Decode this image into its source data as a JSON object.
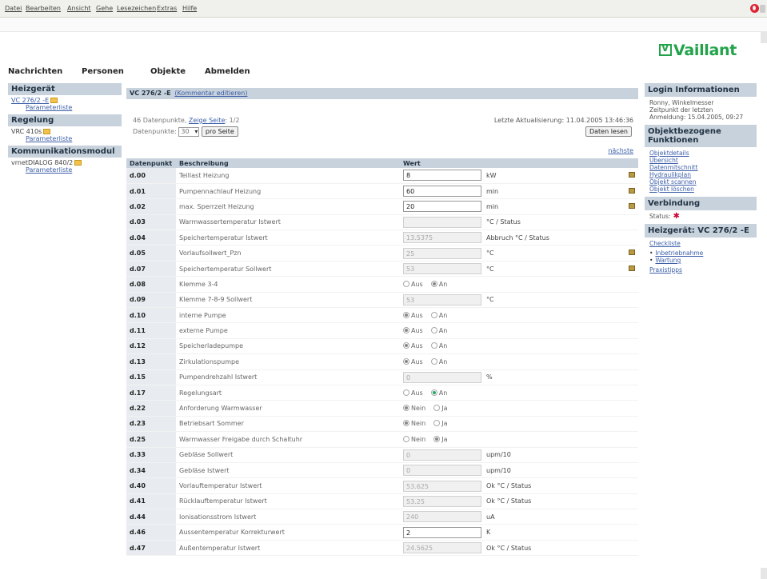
{
  "browser": {
    "menu": [
      "Datei",
      "Bearbeiten",
      "Ansicht",
      "Gehe",
      "Lesezeichen",
      "Extras",
      "Hilfe"
    ]
  },
  "logo": "Vaillant",
  "nav": [
    "Nachrichten",
    "Personen",
    "Objekte",
    "Abmelden"
  ],
  "left": {
    "heizgeraet": {
      "title": "Heizgerät",
      "item": "VC 276/2 -E",
      "sub": "Parameterliste"
    },
    "regelung": {
      "title": "Regelung",
      "item": "VRC 410s",
      "sub": "Parameterliste"
    },
    "kommunikation": {
      "title": "Kommunikationsmodul",
      "item": "vrnetDIALOG 840/2",
      "sub": "Parameterliste"
    }
  },
  "main": {
    "title": "VC 276/2 -E",
    "edit_link": "(Kommentar editieren)",
    "count": "46 Datenpunkte",
    "page_label": "Zeige Seite",
    "page_value": "1/2",
    "per_page_label": "Datenpunkte",
    "per_page_value": "30",
    "per_page_button": "pro Seite",
    "updated": "Letzte Aktualisierung: 11.04.2005 13:46:36",
    "read_button": "Daten lesen",
    "next": "nächste",
    "col_dp": "Datenpunkt",
    "col_desc": "Beschreibung",
    "col_val": "Wert"
  },
  "rows": [
    {
      "dp": "d.00",
      "desc": "Teillast Heizung",
      "value": "8",
      "unit": "kW",
      "editable": true
    },
    {
      "dp": "d.01",
      "desc": "Pumpennachlauf Heizung",
      "value": "60",
      "unit": "min",
      "editable": true
    },
    {
      "dp": "d.02",
      "desc": "max. Sperrzeit Heizung",
      "value": "20",
      "unit": "min",
      "editable": true
    },
    {
      "dp": "d.03",
      "desc": "Warmwassertemperatur Istwert",
      "value": "",
      "unit": "°C / Status",
      "editable": false,
      "ro": true
    },
    {
      "dp": "d.04",
      "desc": "Speichertemperatur Istwert",
      "value": "13.5375",
      "unit": "Abbruch °C / Status",
      "editable": false,
      "ro": true
    },
    {
      "dp": "d.05",
      "desc": "Vorlaufsollwert_Pzn",
      "value": "25",
      "unit": "°C",
      "editable": true,
      "ro": true
    },
    {
      "dp": "d.07",
      "desc": "Speichertemperatur Sollwert",
      "value": "53",
      "unit": "°C",
      "editable": true,
      "ro": true
    },
    {
      "dp": "d.08",
      "desc": "Klemme 3-4",
      "radio": [
        "Aus",
        "An"
      ],
      "sel": 1
    },
    {
      "dp": "d.09",
      "desc": "Klemme 7-8-9 Sollwert",
      "value": "53",
      "unit": "°C",
      "editable": false,
      "ro": true
    },
    {
      "dp": "d.10",
      "desc": "interne Pumpe",
      "radio": [
        "Aus",
        "An"
      ],
      "sel": 0
    },
    {
      "dp": "d.11",
      "desc": "externe Pumpe",
      "radio": [
        "Aus",
        "An"
      ],
      "sel": 0
    },
    {
      "dp": "d.12",
      "desc": "Speicherladepumpe",
      "radio": [
        "Aus",
        "An"
      ],
      "sel": 0
    },
    {
      "dp": "d.13",
      "desc": "Zirkulationspumpe",
      "radio": [
        "Aus",
        "An"
      ],
      "sel": 0
    },
    {
      "dp": "d.15",
      "desc": "Pumpendrehzahl Istwert",
      "value": "0",
      "unit": "%",
      "editable": false,
      "ro": true
    },
    {
      "dp": "d.17",
      "desc": "Regelungsart",
      "radio": [
        "Aus",
        "An"
      ],
      "sel": 1,
      "active": true
    },
    {
      "dp": "d.22",
      "desc": "Anforderung Warmwasser",
      "radio": [
        "Nein",
        "Ja"
      ],
      "sel": 0
    },
    {
      "dp": "d.23",
      "desc": "Betriebsart Sommer",
      "radio": [
        "Nein",
        "Ja"
      ],
      "sel": 0
    },
    {
      "dp": "d.25",
      "desc": "Warmwasser Freigabe durch Schaltuhr",
      "radio": [
        "Nein",
        "Ja"
      ],
      "sel": 1
    },
    {
      "dp": "d.33",
      "desc": "Gebläse Sollwert",
      "value": "0",
      "unit": "upm/10",
      "editable": false,
      "ro": true
    },
    {
      "dp": "d.34",
      "desc": "Gebläse Istwert",
      "value": "0",
      "unit": "upm/10",
      "editable": false,
      "ro": true
    },
    {
      "dp": "d.40",
      "desc": "Vorlauftemperatur Istwert",
      "value": "53.625",
      "unit": "Ok °C / Status",
      "editable": false,
      "ro": true
    },
    {
      "dp": "d.41",
      "desc": "Rücklauftemperatur Istwert",
      "value": "53.25",
      "unit": "Ok °C / Status",
      "editable": false,
      "ro": true
    },
    {
      "dp": "d.44",
      "desc": "Ionisationsstrom Istwert",
      "value": "240",
      "unit": "uA",
      "editable": false,
      "ro": true
    },
    {
      "dp": "d.46",
      "desc": "Aussentemperatur Korrekturwert",
      "value": "2",
      "unit": "K",
      "editable": false
    },
    {
      "dp": "d.47",
      "desc": "Außentemperatur Istwert",
      "value": "24.5625",
      "unit": "Ok °C / Status",
      "editable": false,
      "ro": true
    }
  ],
  "right": {
    "login": {
      "title": "Login Informationen",
      "name": "Ronny, Winkelmesser",
      "since": "Zeitpunkt der letzten",
      "last": "Anmeldung: 15.04.2005, 09:27"
    },
    "functions": {
      "title": "Objektbezogene Funktionen",
      "links": [
        "Objektdetails",
        "Übersicht",
        "Datenmitschnitt",
        "Hydraulikplan",
        "Objekt scannen",
        "Objekt löschen"
      ]
    },
    "connection": {
      "title": "Verbindung",
      "status": "Status:"
    },
    "device": {
      "title": "Heizgerät: VC 276/2 -E",
      "checklist": "Checkliste",
      "bullets": [
        "Inbetriebnahme",
        "Wartung"
      ],
      "last": "Praxistipps"
    }
  }
}
